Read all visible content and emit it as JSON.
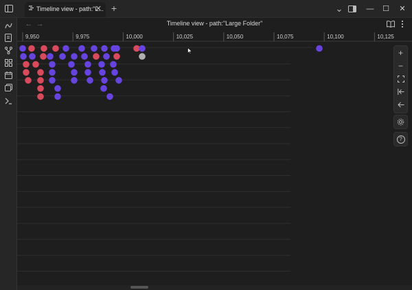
{
  "titlebar": {
    "tab_title": "Timeline view - path:\"L...",
    "close_label": "✕",
    "new_tab_label": "+",
    "dropdown_label": "⌄",
    "minimize_label": "—",
    "maximize_label": "☐",
    "close_window_label": "✕"
  },
  "view": {
    "title": "Timeline view - path:\"Large Folder\"",
    "back_label": "←",
    "forward_label": "→"
  },
  "timeline": {
    "ticks": [
      "9,950",
      "9,975",
      "10,000",
      "10,025",
      "10,050",
      "10,075",
      "10,100",
      "10,125"
    ],
    "row_lines": 14,
    "colors": {
      "red": "#d84a5c",
      "purple": "#6744e0",
      "grey": "#b0b0b0",
      "background": "#1e1e1e",
      "grid": "#3a3a3a"
    },
    "dots": [
      {
        "col": 0,
        "row": 0,
        "color": "purple"
      },
      {
        "col": 1,
        "row": 0,
        "color": "red"
      },
      {
        "col": 2,
        "row": 0,
        "color": "red"
      },
      {
        "col": 3,
        "row": 0,
        "color": "red"
      },
      {
        "col": 4,
        "row": 0,
        "color": "purple"
      },
      {
        "col": 5,
        "row": 0,
        "color": "purple"
      },
      {
        "col": 6,
        "row": 0,
        "color": "purple"
      },
      {
        "col": 7,
        "row": 0,
        "color": "purple"
      },
      {
        "col": 8,
        "row": 0,
        "color": "purple"
      },
      {
        "col": 9,
        "row": 0,
        "color": "purple"
      },
      {
        "col": 10,
        "row": 0,
        "color": "red"
      },
      {
        "col": 11,
        "row": 0,
        "color": "purple"
      },
      {
        "col": 0,
        "row": 1,
        "color": "purple"
      },
      {
        "col": 1,
        "row": 1,
        "color": "purple"
      },
      {
        "col": 2,
        "row": 1,
        "color": "red"
      },
      {
        "col": 3,
        "row": 1,
        "color": "purple"
      },
      {
        "col": 4,
        "row": 1,
        "color": "purple"
      },
      {
        "col": 5,
        "row": 1,
        "color": "purple"
      },
      {
        "col": 6,
        "row": 1,
        "color": "purple"
      },
      {
        "col": 7,
        "row": 1,
        "color": "red"
      },
      {
        "col": 8,
        "row": 1,
        "color": "purple"
      },
      {
        "col": 9,
        "row": 1,
        "color": "red"
      },
      {
        "col": 10,
        "row": 1,
        "color": "grey"
      },
      {
        "col": 0,
        "row": 2,
        "color": "red"
      },
      {
        "col": 1,
        "row": 2,
        "color": "red"
      },
      {
        "col": 2,
        "row": 2,
        "color": "purple"
      },
      {
        "col": 3,
        "row": 2,
        "color": "purple"
      },
      {
        "col": 4,
        "row": 2,
        "color": "purple"
      },
      {
        "col": 5,
        "row": 2,
        "color": "purple"
      },
      {
        "col": 6,
        "row": 2,
        "color": "purple"
      },
      {
        "col": 0,
        "row": 3,
        "color": "red"
      },
      {
        "col": 1,
        "row": 3,
        "color": "red"
      },
      {
        "col": 2,
        "row": 3,
        "color": "purple"
      },
      {
        "col": 3,
        "row": 3,
        "color": "purple"
      },
      {
        "col": 4,
        "row": 3,
        "color": "purple"
      },
      {
        "col": 5,
        "row": 3,
        "color": "purple"
      },
      {
        "col": 6,
        "row": 3,
        "color": "purple"
      },
      {
        "col": 0,
        "row": 4,
        "color": "red"
      },
      {
        "col": 1,
        "row": 4,
        "color": "red"
      },
      {
        "col": 2,
        "row": 4,
        "color": "purple"
      },
      {
        "col": 3,
        "row": 4,
        "color": "purple"
      },
      {
        "col": 4,
        "row": 4,
        "color": "purple"
      },
      {
        "col": 5,
        "row": 4,
        "color": "purple"
      },
      {
        "col": 6,
        "row": 4,
        "color": "purple"
      },
      {
        "col": 1,
        "row": 5,
        "color": "red"
      },
      {
        "col": 2,
        "row": 5,
        "color": "purple"
      },
      {
        "col": 5,
        "row": 5,
        "color": "purple"
      },
      {
        "col": 1,
        "row": 6,
        "color": "red"
      },
      {
        "col": 2,
        "row": 6,
        "color": "purple"
      },
      {
        "col": 5,
        "row": 6,
        "color": "purple"
      }
    ]
  },
  "controls": {
    "zoom_in": "+",
    "zoom_out": "−",
    "help": "?"
  }
}
